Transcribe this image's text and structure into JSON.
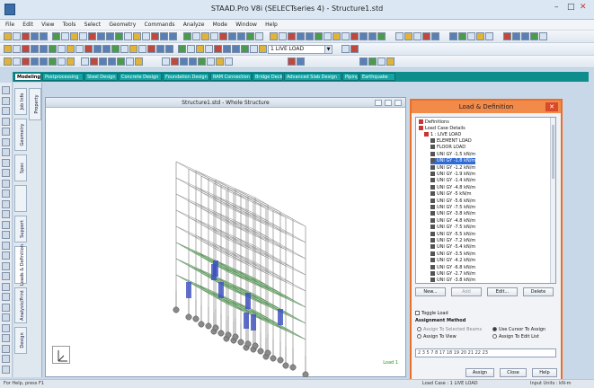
{
  "window": {
    "title": "STAAD.Pro V8i (SELECTseries 4) - Structure1.std",
    "minimize": "–",
    "maximize": "□",
    "close": "✕"
  },
  "menu": [
    "File",
    "Edit",
    "View",
    "Tools",
    "Select",
    "Geometry",
    "Commands",
    "Analyze",
    "Mode",
    "Window",
    "Help"
  ],
  "toolbar": {
    "load_combo": "1 LIVE LOAD"
  },
  "tabs": [
    "Modeling",
    "Postprocessing",
    "Steel Design",
    "Concrete Design",
    "Foundation Design",
    "RAM Connection",
    "Bridge Deck",
    "Advanced Slab Design",
    "Piping",
    "Earthquake"
  ],
  "vertical_tabs": [
    "Job Info",
    "Geometry",
    "Property",
    "Spec",
    "Support",
    "Loads & Definition",
    "Analysis/Print",
    "Design"
  ],
  "view": {
    "title": "Structure1.std - Whole Structure",
    "load_label": "Load 1"
  },
  "colors": {
    "accent": "#0f8c8c",
    "dialog_border": "#e8702a",
    "selection": "#2f6bd6",
    "load_fill": "#44dd44",
    "member_blue": "#3b4fbf"
  },
  "dialog": {
    "title": "Load & Definition",
    "close_icon": "close-icon",
    "tree": {
      "root": "Definitions",
      "cases": "Load Case Details",
      "case": "1 : LIVE LOAD",
      "items": [
        "ELEMENT LOAD",
        "FLOOR LOAD",
        "UNI GY -1.5 kN/m",
        "UNI GY -1.8 kN/m",
        "UNI GY -1.2 kN/m",
        "UNI GY -1.9 kN/m",
        "UNI GY -1.4 kN/m",
        "UNI GY -4.8 kN/m",
        "UNI GY -5 kN/m",
        "UNI GY -5.6 kN/m",
        "UNI GY -7.5 kN/m",
        "UNI GY -3.8 kN/m",
        "UNI GY -4.8 kN/m",
        "UNI GY -7.5 kN/m",
        "UNI GY -5.5 kN/m",
        "UNI GY -7.2 kN/m",
        "UNI GY -5.4 kN/m",
        "UNI GY -3.5 kN/m",
        "UNI GY -4.2 kN/m",
        "UNI GY -6.8 kN/m",
        "UNI GY -2.7 kN/m",
        "UNI GY -3.8 kN/m"
      ],
      "selected_index": 3
    },
    "buttons": {
      "new": "New...",
      "add": "Add",
      "edit": "Edit...",
      "delete": "Delete"
    },
    "toggle_load": "Toggle Load",
    "assignment_method": "Assignment Method",
    "assign_to_selected": "Assign To Selected Beams",
    "assign_to_view": "Assign To View",
    "use_cursor": "Use Cursor To Assign",
    "assign_to_edit": "Assign To Edit List",
    "edit_list": "2 3 5 7 8 17 18 19 20 21 22 23",
    "assign": "Assign",
    "close": "Close",
    "help": "Help"
  },
  "status": {
    "left": "For Help, press F1",
    "mid": "Load Case : 1 LIVE LOAD",
    "right": "Input Units : kN-m"
  }
}
